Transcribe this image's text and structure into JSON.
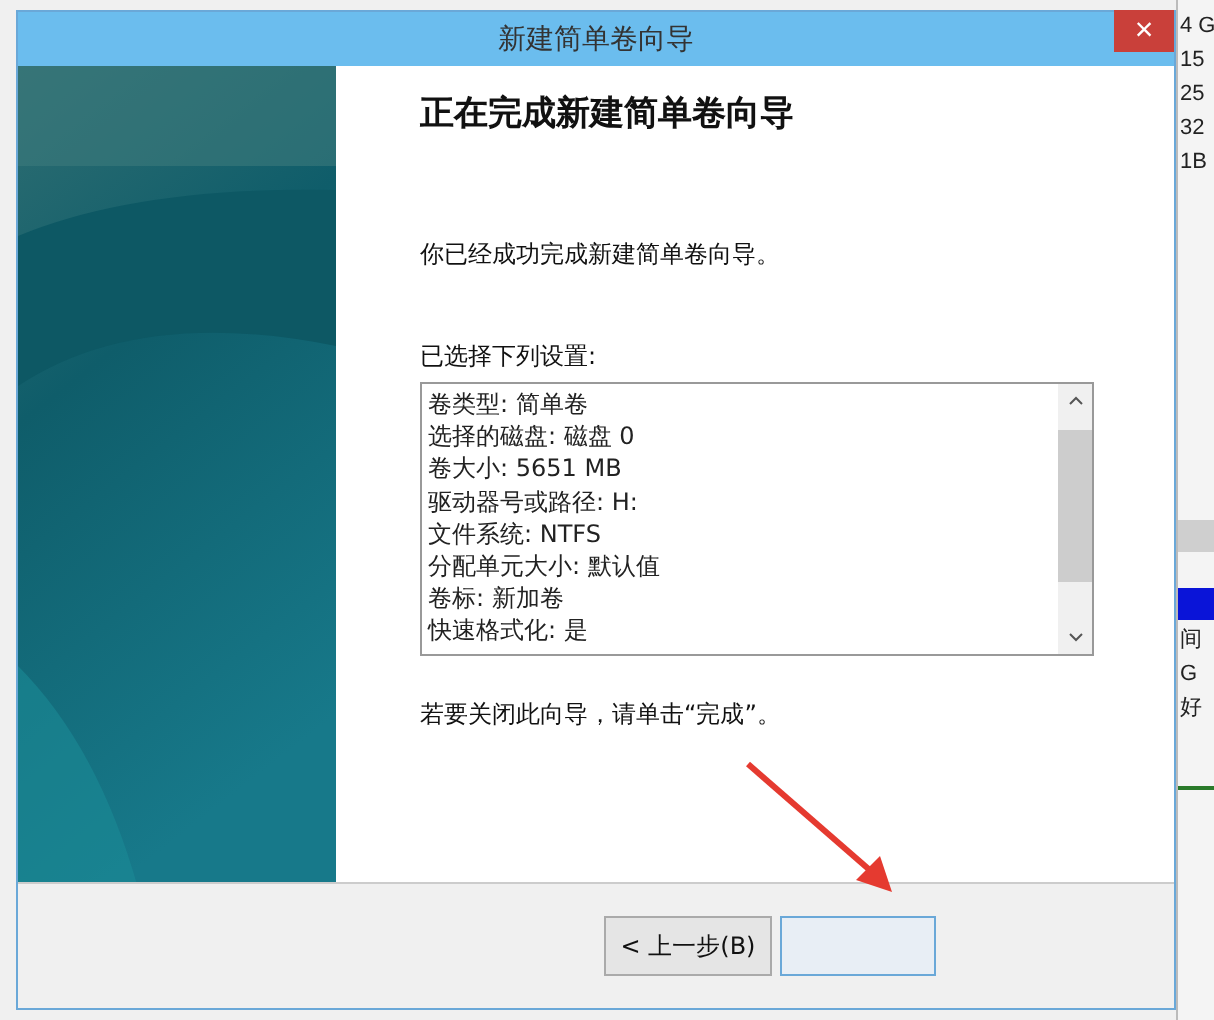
{
  "background_window": {
    "right_texts": [
      "4 G",
      "15",
      "25",
      "32",
      "1B"
    ],
    "lower_texts": [
      "间",
      "G",
      "好"
    ]
  },
  "window": {
    "title": "新建简单卷向导",
    "close": "×"
  },
  "heading": "正在完成新建简单卷向导",
  "message": "你已经成功完成新建简单卷向导。",
  "settings_label": "已选择下列设置:",
  "settings": [
    "卷类型: 简单卷",
    "选择的磁盘: 磁盘 0",
    "卷大小: 5651 MB",
    "驱动器号或路径: H:",
    "文件系统: NTFS",
    "分配单元大小: 默认值",
    "卷标: 新加卷",
    "快速格式化: 是"
  ],
  "footer_note": "若要关闭此向导，请单击“完成”。",
  "buttons": [
    {
      "label": "< 上一步(B)",
      "kind": "back"
    },
    {
      "kind": "finish"
    }
  ]
}
